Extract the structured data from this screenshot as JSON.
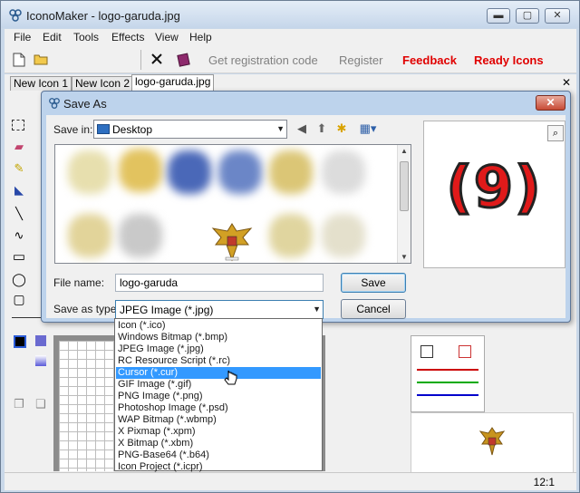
{
  "app": {
    "title": "IconoMaker - logo-garuda.jpg",
    "window_controls": {
      "minimize": "▬",
      "maximize": "▢",
      "close": "✕"
    }
  },
  "menu": [
    "File",
    "Edit",
    "Tools",
    "Effects",
    "View",
    "Help"
  ],
  "toolbar": {
    "icons": [
      "new-file-icon",
      "open-folder-icon",
      "close-x-icon",
      "book-icon"
    ],
    "links": [
      {
        "label": "Get registration code",
        "color": "#808080"
      },
      {
        "label": "Register",
        "color": "#808080"
      },
      {
        "label": "Feedback",
        "color": "#e00000"
      },
      {
        "label": "Ready Icons",
        "color": "#e00000"
      }
    ]
  },
  "tabs": [
    "New Icon 1",
    "New Icon 2",
    "logo-garuda.jpg"
  ],
  "active_tab": 2,
  "status": {
    "zoom": "12:1"
  },
  "dialog": {
    "title": "Save As",
    "save_in_label": "Save in:",
    "save_in_value": "Desktop",
    "file_name_label": "File name:",
    "file_name_value": "logo-garuda",
    "save_as_type_label": "Save as type:",
    "save_as_type_value": "JPEG Image (*.jpg)",
    "save_button": "Save",
    "cancel_button": "Cancel",
    "preview_label": "(9)",
    "accent_color": "#e01a1a"
  },
  "file_types": [
    "Icon (*.ico)",
    "Windows Bitmap (*.bmp)",
    "JPEG Image (*.jpg)",
    "RC Resource Script (*.rc)",
    "Cursor (*.cur)",
    "GIF Image (*.gif)",
    "PNG Image (*.png)",
    "Photoshop Image (*.psd)",
    "WAP Bitmap (*.wbmp)",
    "X Pixmap (*.xpm)",
    "X Bitmap (*.xbm)",
    "PNG-Base64 (*.b64)",
    "Icon Project (*.icpr)"
  ],
  "selected_file_type": 4
}
